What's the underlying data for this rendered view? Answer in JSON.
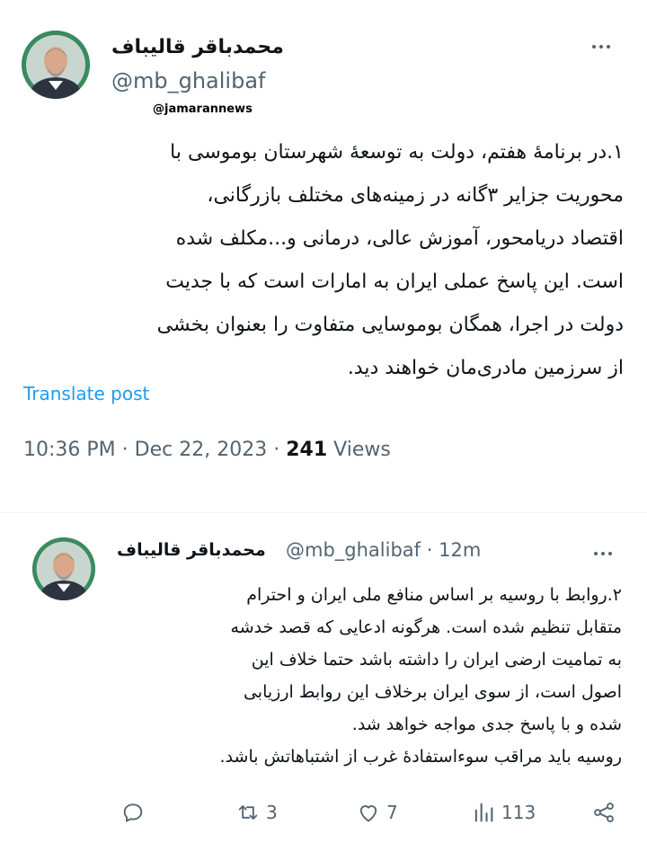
{
  "tweet1": {
    "author_name": "محمدباقر قالیباف",
    "handle": "@mb_ghalibaf",
    "watermark": "@jamarannews",
    "lines": [
      "۱.در برنامهٔ هفتم، دولت به توسعهٔ شهرستان بوموسی با",
      "محوریت جزایر ۳گانه در زمینه‌های مختلف بازرگانی،",
      "اقتصاد دریامحور، آموزش عالی، درمانی و...مکلف شده",
      "است. این پاسخ عملی ایران به امارات است که با جدیت",
      "دولت در اجرا، همگان بوموسایی متفاوت را بعنوان بخشی",
      "از سرزمین مادری‌مان خواهند دید."
    ],
    "translate_label": "Translate post",
    "time": "10:36 PM",
    "date": "Dec 22, 2023",
    "views_count": "241",
    "views_label": "Views"
  },
  "tweet2": {
    "author_name": "محمدباقر قالیباف",
    "handle": "@mb_ghalibaf",
    "time_ago": "12m",
    "lines": [
      "۲.روابط با روسیه بر اساس منافع ملی ایران و احترام",
      "متقابل تنظیم شده است. هرگونه ادعایی که قصد خدشه",
      "به تمامیت ارضی ایران را داشته باشد حتما خلاف این",
      "اصول است، از سوی ایران برخلاف این روابط ارزیابی",
      "شده و با پاسخ جدی مواجه خواهد شد.",
      "روسیه باید مراقب سوءاستفادهٔ غرب از اشتباهاتش باشد."
    ],
    "actions": {
      "reply_count": "",
      "repost_count": "3",
      "like_count": "7",
      "views_count": "113"
    }
  },
  "colors": {
    "link": "#1d9bf0",
    "secondary": "#536471",
    "text": "#0f1419",
    "avatar_ring": "#2e7d5b"
  },
  "icons": [
    "more-icon",
    "reply-icon",
    "repost-icon",
    "like-icon",
    "views-icon",
    "share-icon"
  ]
}
